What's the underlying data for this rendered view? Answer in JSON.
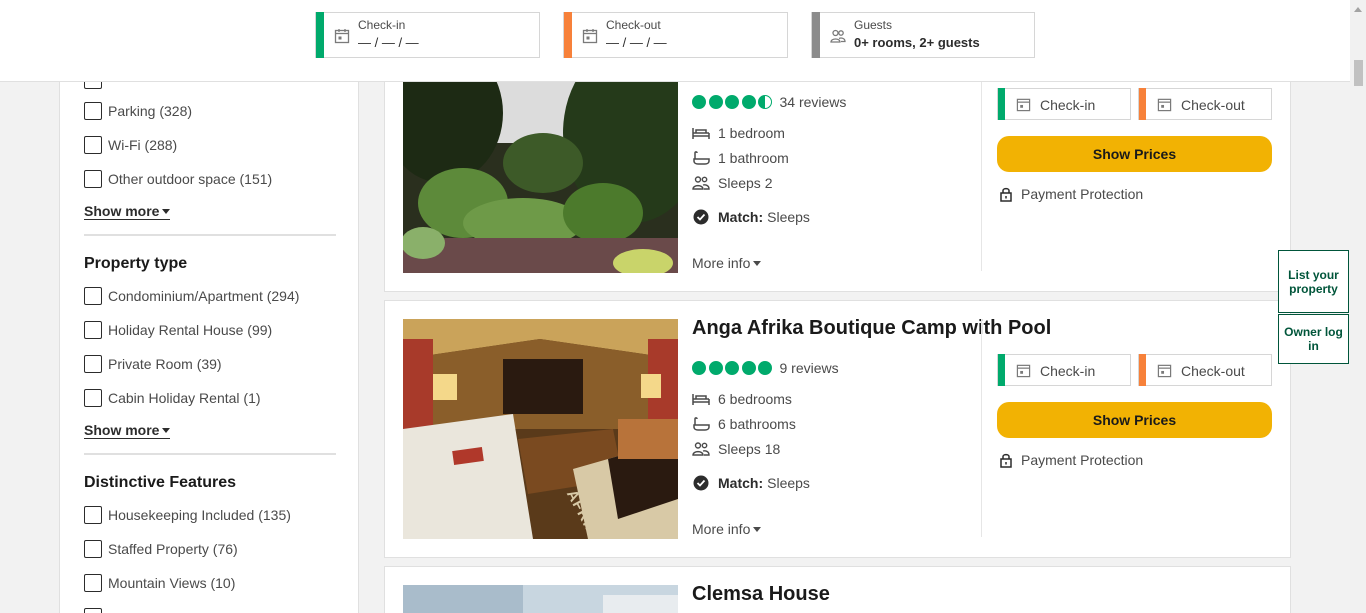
{
  "search_bar": {
    "checkin": {
      "label": "Check-in",
      "value": "— / — / —",
      "color": "#00aa6c"
    },
    "checkout": {
      "label": "Check-out",
      "value": "— / — / —",
      "color": "#f7813a"
    },
    "guests": {
      "label": "Guests",
      "value": "0+ rooms, 2+ guests",
      "color": "#8c8c8c"
    }
  },
  "sidebar": {
    "amenities": [
      {
        "label": "Parking (328)"
      },
      {
        "label": "Wi-Fi (288)"
      },
      {
        "label": "Other outdoor space (151)"
      }
    ],
    "show_more_1": "Show more",
    "property_type": {
      "title": "Property type",
      "items": [
        {
          "label": "Condominium/Apartment (294)"
        },
        {
          "label": "Holiday Rental House (99)"
        },
        {
          "label": "Private Room (39)"
        },
        {
          "label": "Cabin Holiday Rental (1)"
        }
      ],
      "show_more": "Show more"
    },
    "features": {
      "title": "Distinctive Features",
      "items": [
        {
          "label": "Housekeeping Included (135)"
        },
        {
          "label": "Staffed Property (76)"
        },
        {
          "label": "Mountain Views (10)"
        }
      ]
    }
  },
  "listings": [
    {
      "title": "",
      "rating": 4.5,
      "reviews": "34 reviews",
      "bedrooms": "1 bedroom",
      "bathrooms": "1 bathroom",
      "sleeps": "Sleeps 2",
      "match_label": "Match:",
      "match_value": "Sleeps",
      "more_info": "More info",
      "checkin": "Check-in",
      "checkout": "Check-out",
      "cta": "Show Prices",
      "protection": "Payment Protection"
    },
    {
      "title": "Anga Afrika Boutique Camp with Pool",
      "rating": 5,
      "reviews": "9 reviews",
      "bedrooms": "6 bedrooms",
      "bathrooms": "6 bathrooms",
      "sleeps": "Sleeps 18",
      "match_label": "Match:",
      "match_value": "Sleeps",
      "more_info": "More info",
      "checkin": "Check-in",
      "checkout": "Check-out",
      "cta": "Show Prices",
      "protection": "Payment Protection",
      "photo_text": "AFRIKA"
    },
    {
      "title": "Clemsa House"
    }
  ],
  "side_buttons": {
    "list_property": "List your property",
    "owner_login": "Owner log in"
  },
  "colors": {
    "rating_green": "#00aa6c",
    "cta_yellow": "#f2b203",
    "checkin_green": "#00aa6c",
    "checkout_orange": "#f7813a",
    "brand_dark_green": "#00553a"
  }
}
